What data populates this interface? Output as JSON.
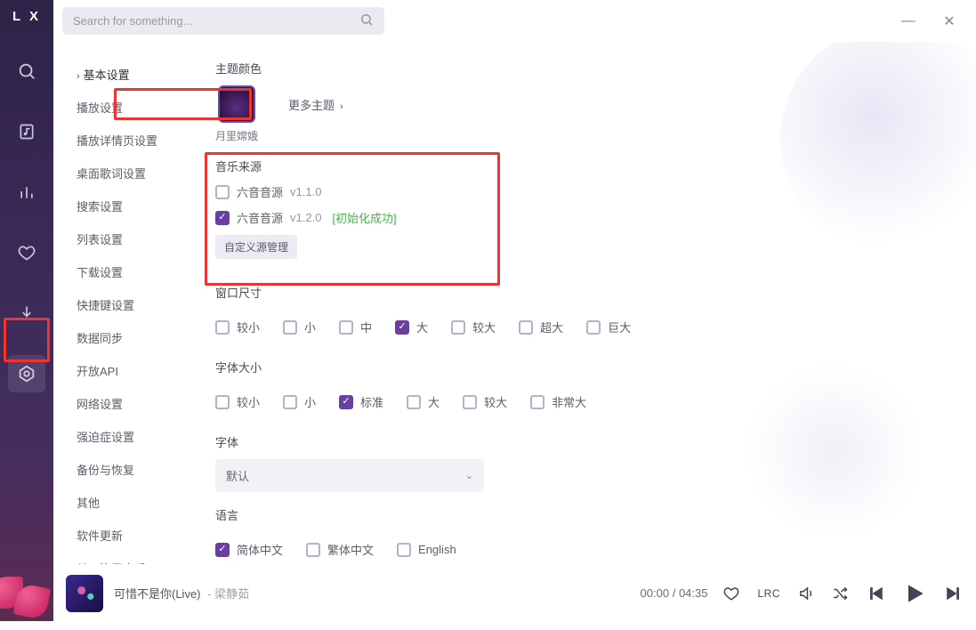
{
  "app": {
    "logo": "L X"
  },
  "search": {
    "placeholder": "Search for something..."
  },
  "window": {
    "minimize": "—",
    "close": "✕"
  },
  "sidebar": {
    "icons": [
      "search",
      "music-file",
      "chart",
      "heart",
      "download",
      "settings"
    ]
  },
  "settings_nav": {
    "items": [
      {
        "label": "基本设置",
        "active": true
      },
      {
        "label": "播放设置"
      },
      {
        "label": "播放详情页设置"
      },
      {
        "label": "桌面歌词设置"
      },
      {
        "label": "搜索设置"
      },
      {
        "label": "列表设置"
      },
      {
        "label": "下载设置"
      },
      {
        "label": "快捷键设置"
      },
      {
        "label": "数据同步"
      },
      {
        "label": "开放API"
      },
      {
        "label": "网络设置"
      },
      {
        "label": "强迫症设置"
      },
      {
        "label": "备份与恢复"
      },
      {
        "label": "其他"
      },
      {
        "label": "软件更新"
      },
      {
        "label": "关于洛雪音乐"
      }
    ]
  },
  "panel": {
    "theme": {
      "title": "主题颜色",
      "selected_name": "月里嫦娥",
      "more": "更多主题"
    },
    "source": {
      "title": "音乐来源",
      "items": [
        {
          "name": "六音音源",
          "version": "v1.1.0",
          "checked": false,
          "status": ""
        },
        {
          "name": "六音音源",
          "version": "v1.2.0",
          "checked": true,
          "status": "[初始化成功]"
        }
      ],
      "manage_btn": "自定义源管理"
    },
    "window_size": {
      "title": "窗口尺寸",
      "options": [
        {
          "label": "较小",
          "checked": false
        },
        {
          "label": "小",
          "checked": false
        },
        {
          "label": "中",
          "checked": false
        },
        {
          "label": "大",
          "checked": true
        },
        {
          "label": "较大",
          "checked": false
        },
        {
          "label": "超大",
          "checked": false
        },
        {
          "label": "巨大",
          "checked": false
        }
      ]
    },
    "font_size": {
      "title": "字体大小",
      "options": [
        {
          "label": "较小",
          "checked": false
        },
        {
          "label": "小",
          "checked": false
        },
        {
          "label": "标准",
          "checked": true
        },
        {
          "label": "大",
          "checked": false
        },
        {
          "label": "较大",
          "checked": false
        },
        {
          "label": "非常大",
          "checked": false
        }
      ]
    },
    "font": {
      "title": "字体",
      "selected": "默认"
    },
    "language": {
      "title": "语言",
      "options": [
        {
          "label": "简体中文",
          "checked": true
        },
        {
          "label": "繁体中文",
          "checked": false
        },
        {
          "label": "English",
          "checked": false
        }
      ]
    }
  },
  "player": {
    "title": "可惜不是你(Live)",
    "artist": "- 梁静茹",
    "time_current": "00:00",
    "time_sep": " / ",
    "time_total": "04:35",
    "lrc_label": "LRC"
  }
}
